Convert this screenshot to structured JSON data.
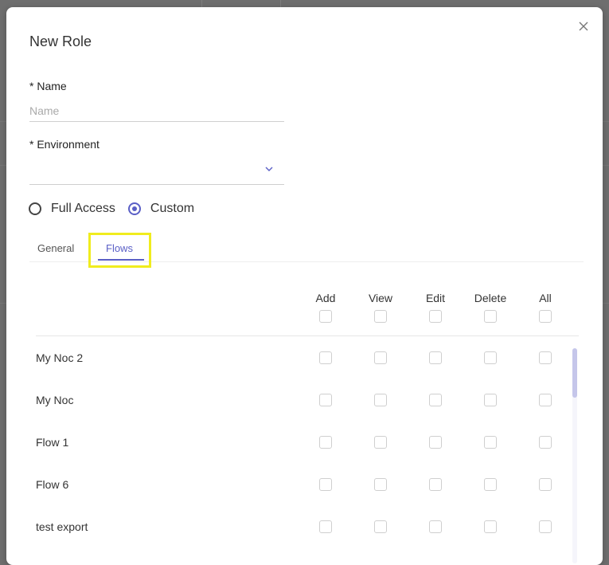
{
  "modal": {
    "title": "New Role",
    "name_label": "* Name",
    "name_placeholder": "Name",
    "name_value": "",
    "environment_label": "* Environment",
    "environment_value": "",
    "access_options": [
      {
        "label": "Full Access",
        "selected": false
      },
      {
        "label": "Custom",
        "selected": true
      }
    ],
    "tabs": [
      {
        "label": "General",
        "active": false
      },
      {
        "label": "Flows",
        "active": true
      }
    ],
    "permission_columns": [
      "Add",
      "View",
      "Edit",
      "Delete",
      "All"
    ],
    "rows": [
      {
        "label": "My Noc 2"
      },
      {
        "label": "My Noc"
      },
      {
        "label": "Flow 1"
      },
      {
        "label": "Flow 6"
      },
      {
        "label": "test export"
      }
    ]
  },
  "colors": {
    "accent": "#5a5fc6",
    "highlight": "#f0ec1e",
    "backdrop": "#6e6e6e"
  },
  "icons": {
    "close": "close-icon",
    "dropdown": "chevron-down-icon"
  }
}
